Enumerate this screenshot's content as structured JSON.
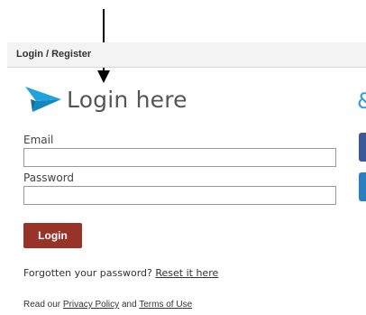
{
  "header": {
    "title": "Login / Register"
  },
  "login": {
    "heading": "Login here",
    "email_label": "Email",
    "email_value": "",
    "password_label": "Password",
    "password_value": "",
    "button_label": "Login",
    "forgot_text": "Forgotten your password? ",
    "reset_link": "Reset it here",
    "policy_prefix": "Read our ",
    "privacy_link": "Privacy Policy",
    "policy_and": " and ",
    "terms_link": "Terms of Use"
  },
  "icons": {
    "heading_icon": "paper-plane-icon",
    "right_icon": "social-icon",
    "arrow": "annotation-arrow"
  },
  "colors": {
    "accent": "#1fa3dc",
    "button": "#983329",
    "facebook": "#3b5998",
    "twitter": "#2a7fc1"
  }
}
